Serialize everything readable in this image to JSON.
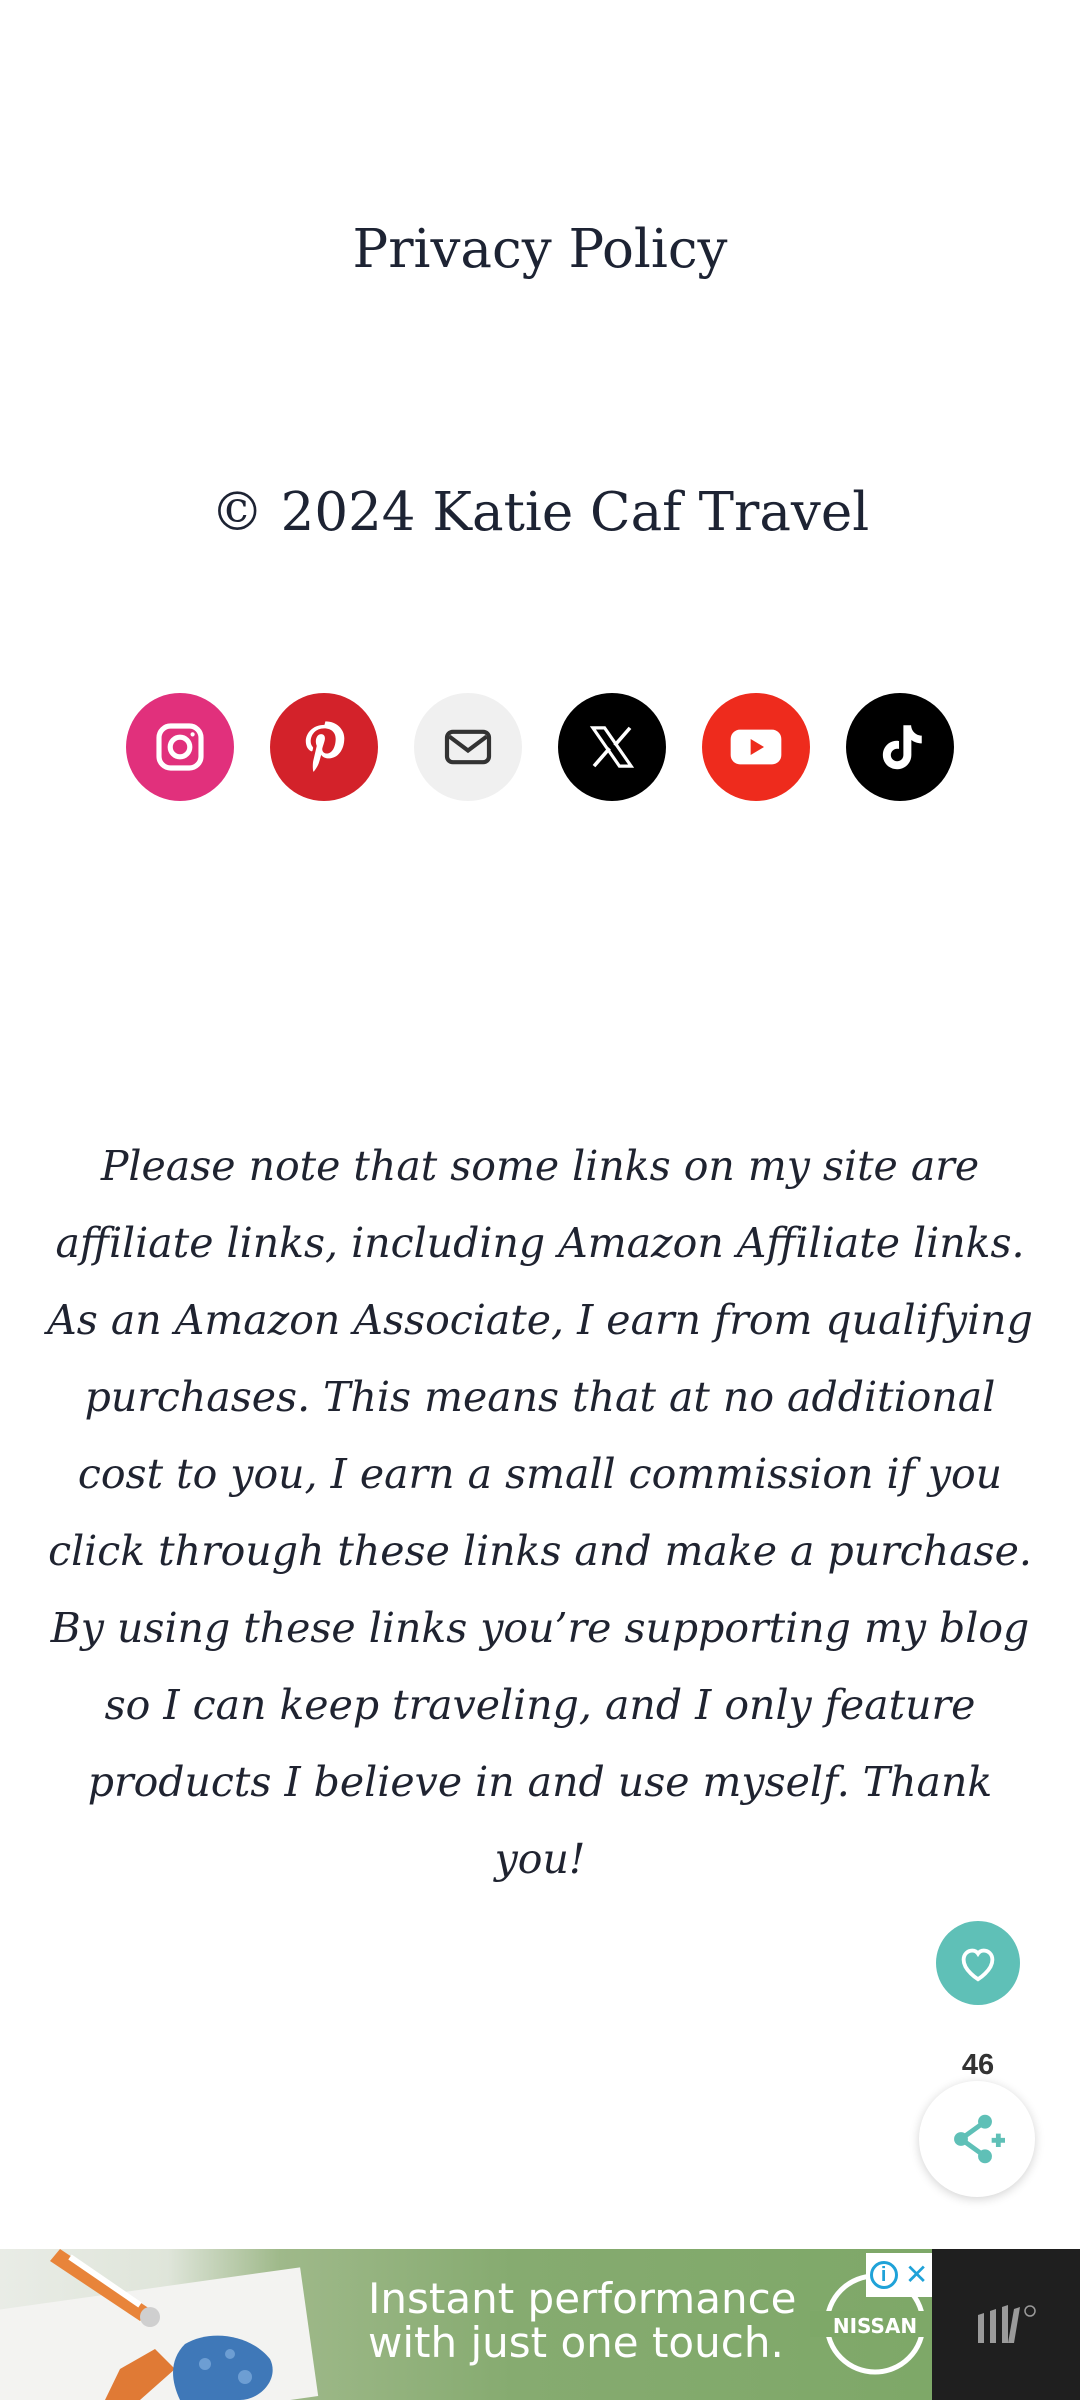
{
  "footer": {
    "privacy_link": "Privacy Policy",
    "copyright": "© 2024 Katie Caf Travel"
  },
  "social": [
    {
      "name": "instagram-icon",
      "color": "#e1307c"
    },
    {
      "name": "pinterest-icon",
      "color": "#d3222a"
    },
    {
      "name": "mail-icon",
      "color": "#f0f0f0"
    },
    {
      "name": "x-icon",
      "color": "#000000"
    },
    {
      "name": "youtube-icon",
      "color": "#ee2b1d"
    },
    {
      "name": "tiktok-icon",
      "color": "#000000"
    }
  ],
  "affiliate_disclaimer": "Please note that some links on my site are affiliate links, including Amazon Affiliate links. As an Amazon Associate, I earn from qualifying purchases. This means that at no additional cost to you, I earn a small commission if you click through these links and make a purchase. By using these links you’re supporting my blog so I can keep traveling, and I only feature products I believe in and use myself. Thank you!",
  "floating": {
    "share_count": "46",
    "accent_color": "#5fc0b7"
  },
  "ad": {
    "headline": "Instant performance with just one touch.",
    "brand": "NISSAN"
  }
}
